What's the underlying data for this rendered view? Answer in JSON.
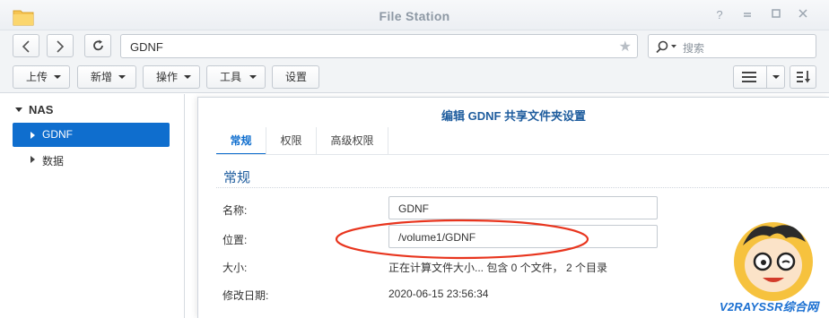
{
  "window": {
    "title": "File Station"
  },
  "toolbar": {
    "path": "GDNF",
    "search_placeholder": "搜索",
    "upload": "上传",
    "create": "新增",
    "action": "操作",
    "tools": "工具",
    "settings": "设置"
  },
  "tree": {
    "root": "NAS",
    "items": [
      {
        "label": "GDNF",
        "selected": true
      },
      {
        "label": "数据",
        "selected": false
      }
    ]
  },
  "dialog": {
    "title": "编辑 GDNF 共享文件夹设置",
    "tabs": [
      "常规",
      "权限",
      "高级权限"
    ],
    "active_tab": "常规",
    "section": "常规",
    "fields": {
      "name_label": "名称:",
      "name_value": "GDNF",
      "location_label": "位置:",
      "location_value": "/volume1/GDNF",
      "size_label": "大小:",
      "size_value": "正在计算文件大小... 包含 0 个文件， 2 个目录",
      "modified_label": "修改日期:",
      "modified_value": "2020-06-15 23:56:34"
    }
  },
  "watermark": {
    "text": "V2RAYSSR综合网"
  },
  "colors": {
    "accent": "#0f6ece",
    "highlight_ellipse": "#e8351e",
    "title_text": "#8d98a4"
  }
}
